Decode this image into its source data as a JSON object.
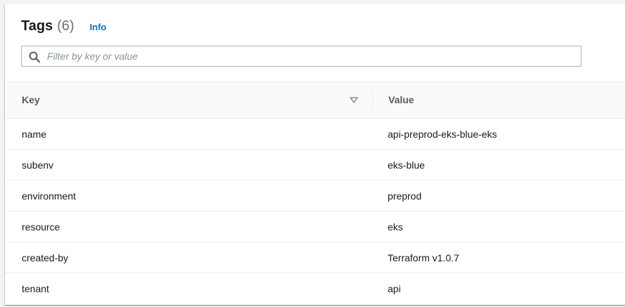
{
  "header": {
    "title": "Tags",
    "count": "(6)",
    "info_label": "Info"
  },
  "search": {
    "placeholder": "Filter by key or value",
    "value": "",
    "icon": "search-icon"
  },
  "table": {
    "columns": [
      "Key",
      "Value"
    ],
    "sort_icon": "sort-down-icon",
    "rows": [
      {
        "key": "name",
        "value": "api-preprod-eks-blue-eks"
      },
      {
        "key": "subenv",
        "value": "eks-blue"
      },
      {
        "key": "environment",
        "value": "preprod"
      },
      {
        "key": "resource",
        "value": "eks"
      },
      {
        "key": "created-by",
        "value": "Terraform v1.0.7"
      },
      {
        "key": "tenant",
        "value": "api"
      }
    ]
  },
  "colors": {
    "link": "#0073bb",
    "header_text": "#545b64",
    "muted": "#687078",
    "border": "#eaeded"
  }
}
